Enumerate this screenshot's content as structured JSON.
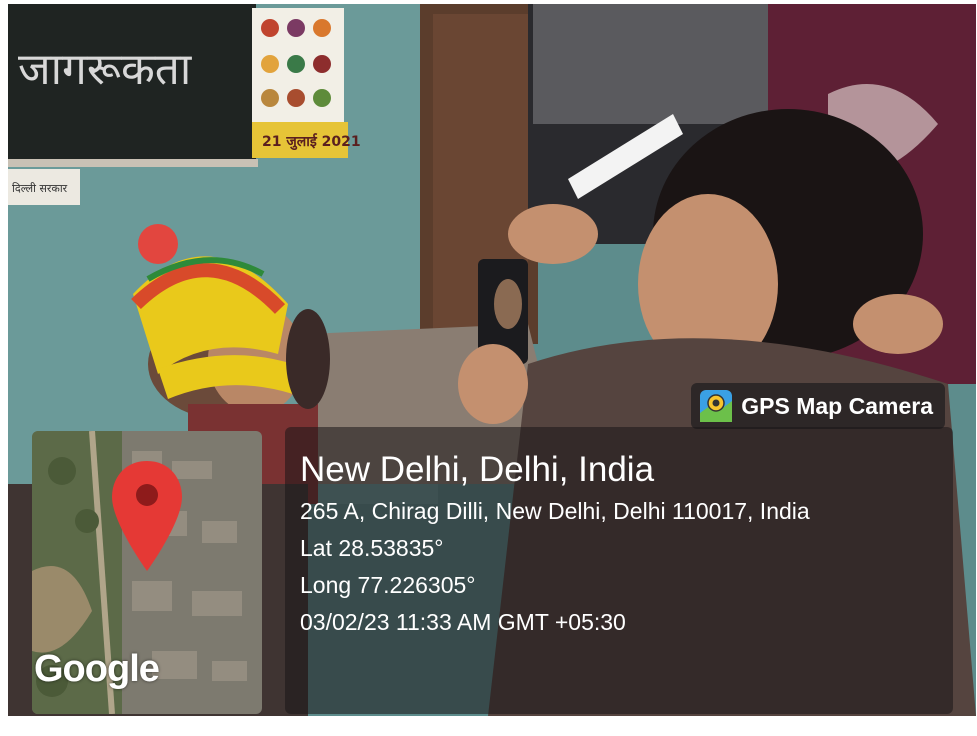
{
  "blackboard": {
    "text": "जागरूकता"
  },
  "calendar": {
    "text": "21 जुलाई 2021"
  },
  "sign": {
    "text": "दिल्ली सरकार"
  },
  "badge": {
    "icon": "map-pin-camera-icon",
    "label": "GPS Map Camera"
  },
  "location": {
    "title": "New Delhi, Delhi, India",
    "address": "265 A, Chirag Dilli, New Delhi, Delhi 110017, India",
    "latitude": "Lat 28.53835°",
    "longitude": "Long 77.226305°",
    "datetime": "03/02/23 11:33 AM GMT +05:30"
  },
  "map": {
    "attribution": "Google",
    "marker": "map-marker-icon"
  },
  "colors": {
    "marker": "#e53935",
    "overlay": "#19161a"
  }
}
